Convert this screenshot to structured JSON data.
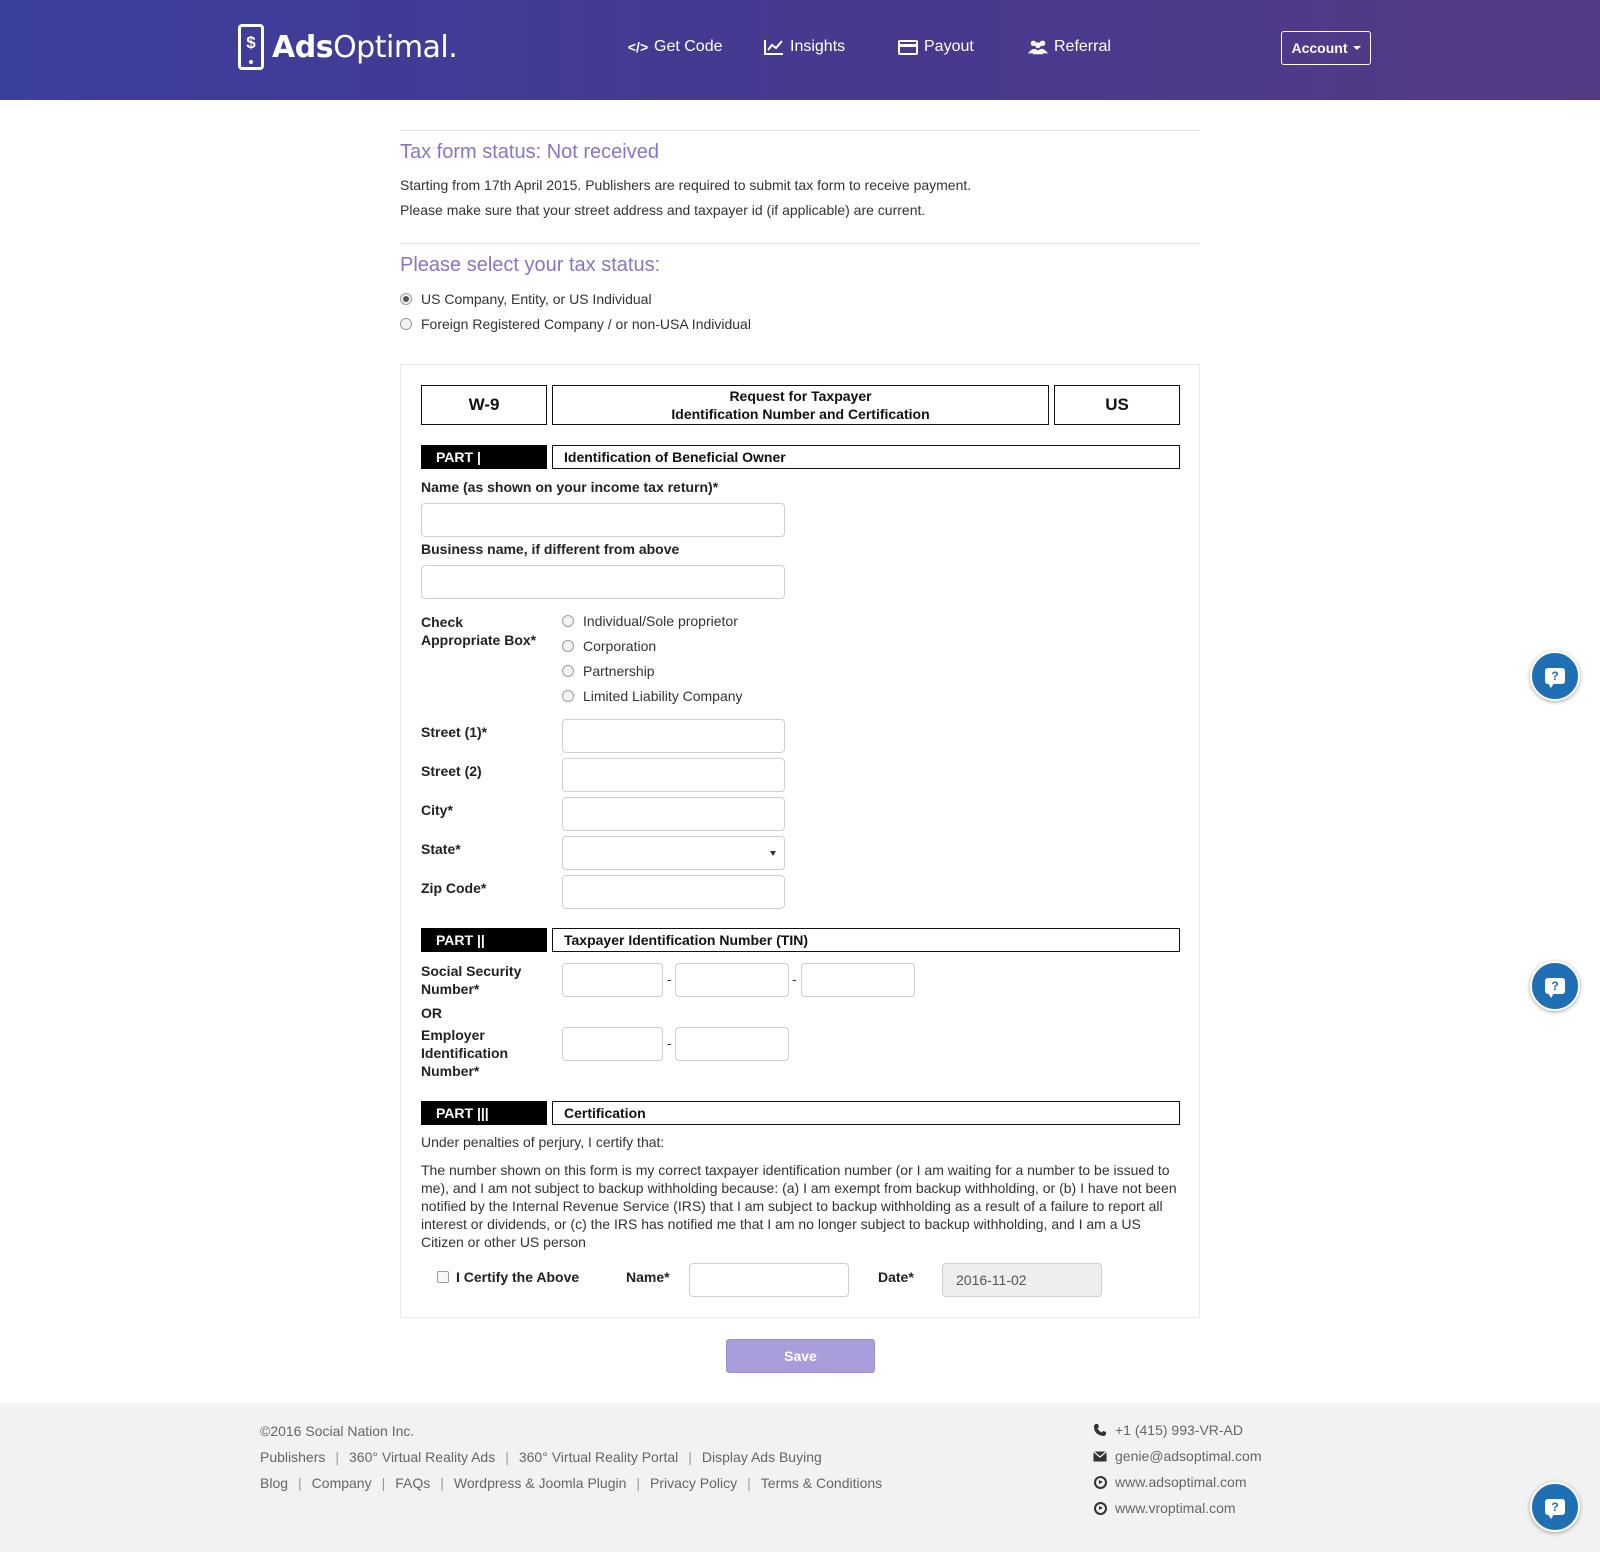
{
  "header": {
    "brand": {
      "bold": "Ads",
      "rest": "Optimal."
    },
    "nav": [
      {
        "label": "Get Code",
        "icon": "code-icon"
      },
      {
        "label": "Insights",
        "icon": "chart-icon"
      },
      {
        "label": "Payout",
        "icon": "credit-card-icon"
      },
      {
        "label": "Referral",
        "icon": "users-icon"
      }
    ],
    "account_label": "Account"
  },
  "status": {
    "title": "Tax form status: Not received",
    "line1": "Starting from 17th April 2015. Publishers are required to submit tax form to receive payment.",
    "line2": "Please make sure that your street address and taxpayer id (if applicable) are current."
  },
  "tax_status": {
    "title": "Please select your tax status:",
    "options": [
      {
        "label": "US Company, Entity, or US Individual",
        "selected": true
      },
      {
        "label": "Foreign Registered Company / or non-USA Individual",
        "selected": false
      }
    ]
  },
  "form": {
    "code": "W-9",
    "title_line1": "Request for Taxpayer",
    "title_line2": "Identification Number and Certification",
    "country": "US",
    "part1": {
      "label": "PART |",
      "title": "Identification of Beneficial Owner",
      "name_label": "Name (as shown on your income tax return)*",
      "business_label": "Business name, if different from above",
      "check_label_1": "Check",
      "check_label_2": "Appropriate Box*",
      "entity_options": [
        "Individual/Sole proprietor",
        "Corporation",
        "Partnership",
        "Limited Liability Company"
      ],
      "street1_label": "Street (1)*",
      "street2_label": "Street (2)",
      "city_label": "City*",
      "state_label": "State*",
      "zip_label": "Zip Code*"
    },
    "part2": {
      "label": "PART ||",
      "title": "Taxpayer Identification Number (TIN)",
      "ssn_label_1": "Social Security",
      "ssn_label_2": "Number*",
      "or_label": "OR",
      "ein_label_1": "Employer",
      "ein_label_2": "Identification",
      "ein_label_3": "Number*",
      "dash": "-"
    },
    "part3": {
      "label": "PART |||",
      "title": "Certification",
      "intro": "Under penalties of perjury, I certify that:",
      "body": "The number shown on this form is my correct taxpayer identification number (or I am waiting for a number to be issued to me), and I am not subject to backup withholding because: (a) I am exempt from backup withholding, or (b) I have not been notified by the Internal Revenue Service (IRS) that I am subject to backup withholding as a result of a failure to report all interest or dividends, or (c) the IRS has notified me that I am no longer subject to backup withholding, and I am a US Citizen or other US person",
      "certify_label": "I Certify the Above",
      "name_label": "Name*",
      "date_label": "Date*",
      "date_value": "2016-11-02"
    },
    "save_label": "Save"
  },
  "footer": {
    "copyright": "©2016 Social Nation Inc.",
    "links_row1": [
      "Publishers",
      "360° Virtual Reality Ads",
      "360° Virtual Reality Portal",
      "Display Ads Buying"
    ],
    "links_row2": [
      "Blog",
      "Company",
      "FAQs",
      "Wordpress & Joomla Plugin",
      "Privacy Policy",
      "Terms & Conditions"
    ],
    "separator": "|",
    "phone": "+1 (415) 993-VR-AD",
    "email": "genie@adsoptimal.com",
    "site1": "www.adsoptimal.com",
    "site2": "www.vroptimal.com"
  },
  "help_glyph": "?",
  "colors": {
    "nav_start": "#3b3f9c",
    "nav_end": "#553a85",
    "accent_purple": "#8a73c9",
    "save_button": "#a99ddb",
    "help_bubble": "#1f6fb5"
  }
}
